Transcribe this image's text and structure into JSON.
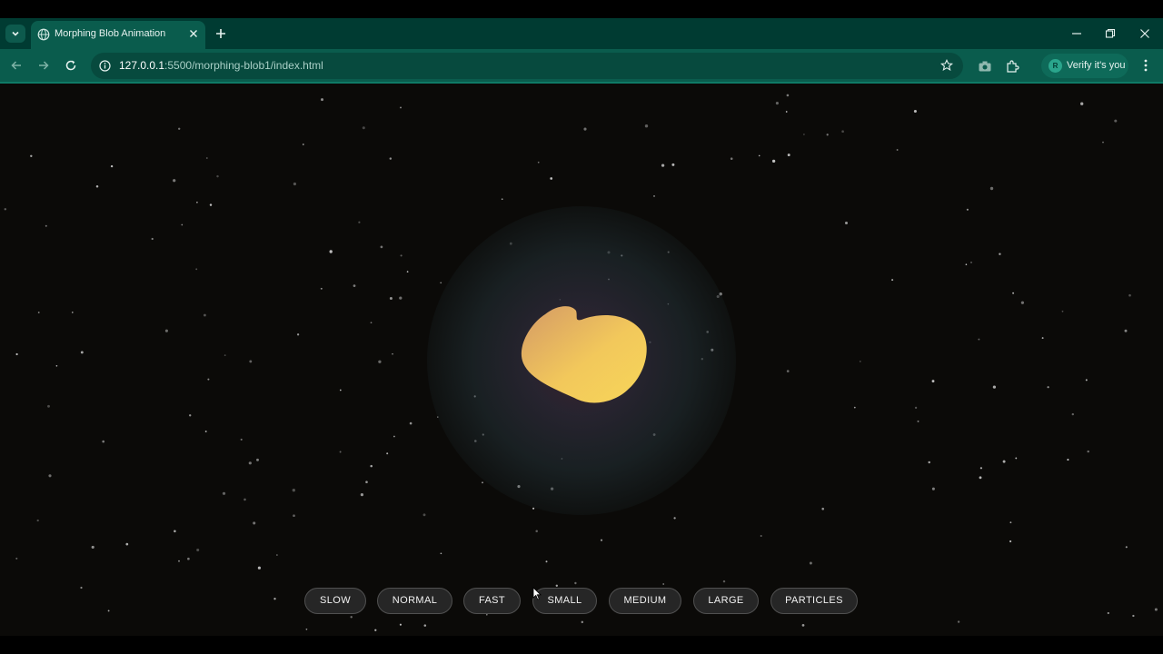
{
  "browser": {
    "tab": {
      "title": "Morphing Blob Animation"
    },
    "address": {
      "host": "127.0.0.1",
      "rest": ":5500/morphing-blob1/index.html"
    },
    "profile": {
      "avatar_letter": "R",
      "label": "Verify it's you"
    }
  },
  "colors": {
    "tabstrip": "#003b32",
    "toolbar": "#0a5c4d",
    "page_background": "#0b0a08",
    "blob_start": "#d9a45e",
    "blob_end": "#f3cf5a",
    "button_bg": "#262626"
  },
  "icons": {
    "tab_search": "chevron-down-icon",
    "favicon": "globe-icon",
    "close_tab": "close-icon",
    "new_tab": "plus-icon",
    "back": "arrow-left-icon",
    "forward": "arrow-right-icon",
    "reload": "reload-icon",
    "site_info": "info-icon",
    "bookmark": "star-icon",
    "screenshot": "camera-icon",
    "extensions": "puzzle-icon",
    "menu": "kebab-icon"
  },
  "controls": [
    {
      "label": "SLOW"
    },
    {
      "label": "NORMAL"
    },
    {
      "label": "FAST"
    },
    {
      "label": "SMALL"
    },
    {
      "label": "MEDIUM"
    },
    {
      "label": "LARGE"
    },
    {
      "label": "PARTICLES"
    }
  ]
}
